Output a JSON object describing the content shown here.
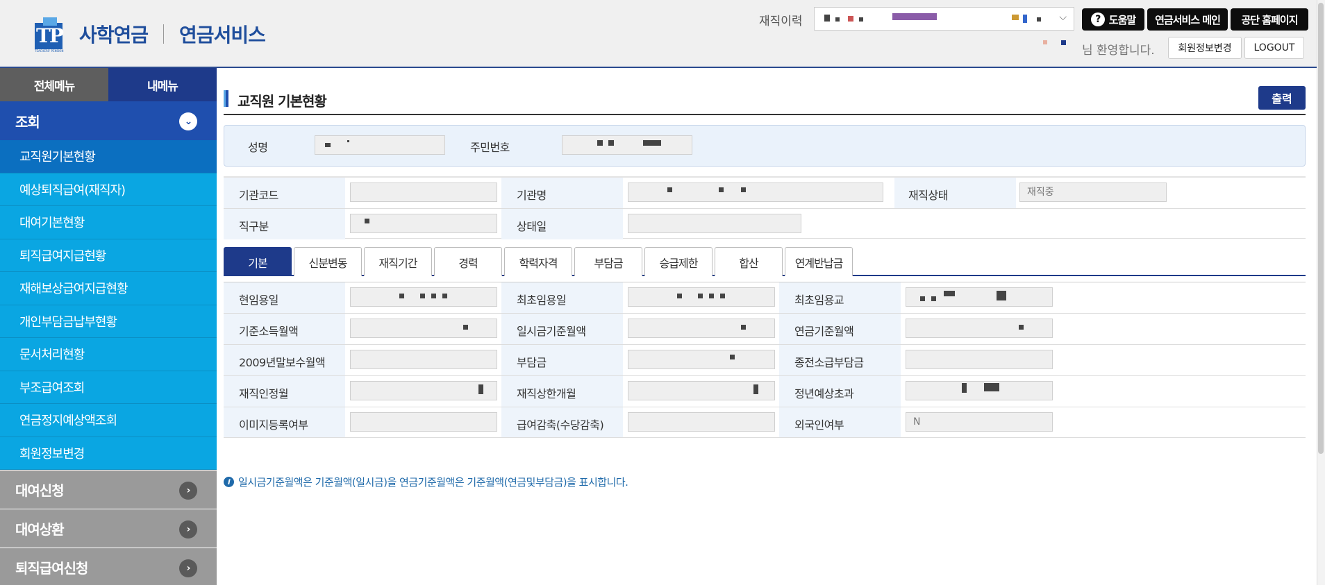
{
  "header": {
    "logo_text": "사학연금",
    "logo_mark": "TP",
    "logo_sub": "TEACHERS' PENSION",
    "service_name": "연금서비스",
    "career_label": "재직이력",
    "buttons": {
      "help": "도움말",
      "pension_main": "연금서비스 메인",
      "homepage": "공단 홈페이지"
    },
    "welcome": "님 환영합니다.",
    "member_edit": "회원정보변경",
    "logout": "LOGOUT"
  },
  "sidebar": {
    "tabs": [
      "전체메뉴",
      "내메뉴"
    ],
    "active_group": "조회",
    "items": [
      "교직원기본현황",
      "예상퇴직급여(재직자)",
      "대여기본현황",
      "퇴직급여지급현황",
      "재해보상급여지급현황",
      "개인부담금납부현황",
      "문서처리현황",
      "부조급여조회",
      "연금정지예상액조회",
      "회원정보변경"
    ],
    "groups": [
      "대여신청",
      "대여상환",
      "퇴직급여신청"
    ]
  },
  "main": {
    "title": "교직원 기본현황",
    "print": "출력",
    "name_label": "성명",
    "rrn_label": "주민번호",
    "info": {
      "inst_code": "기관코드",
      "inst_name": "기관명",
      "status": "재직상태",
      "status_value": "재직중",
      "job_class": "직구분",
      "status_date": "상태일"
    },
    "tabs": [
      "기본",
      "신분변동",
      "재직기간",
      "경력",
      "학력자격",
      "부담금",
      "승급제한",
      "합산",
      "연계반납금"
    ],
    "grid": [
      [
        "현임용일",
        "최초임용일",
        "최초임용교"
      ],
      [
        "기준소득월액",
        "일시금기준월액",
        "연금기준월액"
      ],
      [
        "2009년말보수월액",
        "부담금",
        "종전소급부담금"
      ],
      [
        "재직인정월",
        "재직상한개월",
        "정년예상초과"
      ],
      [
        "이미지등록여부",
        "급여감축(수당감축)",
        "외국인여부"
      ]
    ],
    "foreigner_value": "N",
    "note": "일시금기준월액은 기준월액(일시금)을 연금기준월액은 기준월액(연금및부담금)을 표시합니다."
  },
  "colors": {
    "primary": "#1e3a8a",
    "menu_blue": "#0aa6e2",
    "menu_selected": "#0b6fc0"
  }
}
